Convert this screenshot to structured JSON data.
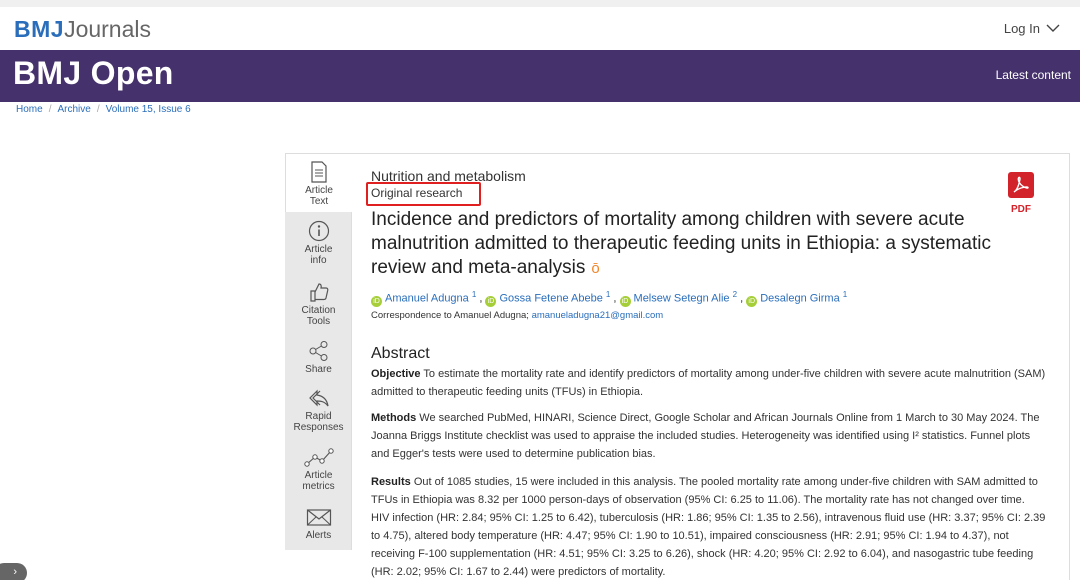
{
  "header": {
    "logo_bmj": "BMJ",
    "logo_journals": "Journals",
    "login_label": "Log In"
  },
  "banner": {
    "journal_name": "BMJ Open",
    "latest_link": "Latest content"
  },
  "breadcrumb": {
    "items": [
      "Home",
      "Archive",
      "Volume 15, Issue 6"
    ],
    "separator": "/"
  },
  "sidebar": {
    "items": [
      {
        "label_line1": "Article",
        "label_line2": "Text",
        "icon": "document-icon"
      },
      {
        "label_line1": "Article",
        "label_line2": "info",
        "icon": "info-icon"
      },
      {
        "label_line1": "Citation",
        "label_line2": "Tools",
        "icon": "thumbs-up-icon"
      },
      {
        "label_line1": "Share",
        "label_line2": "",
        "icon": "share-icon"
      },
      {
        "label_line1": "Rapid",
        "label_line2": "Responses",
        "icon": "reply-icon"
      },
      {
        "label_line1": "Article",
        "label_line2": "metrics",
        "icon": "metrics-icon"
      },
      {
        "label_line1": "Alerts",
        "label_line2": "",
        "icon": "envelope-icon"
      }
    ]
  },
  "article": {
    "subject": "Nutrition and metabolism",
    "type": "Original research",
    "title": "Incidence and predictors of mortality among children with severe acute malnutrition admitted to therapeutic feeding units in Ethiopia: a systematic review and meta-analysis",
    "authors": [
      {
        "name": "Amanuel Adugna",
        "aff": "1"
      },
      {
        "name": "Gossa Fetene Abebe",
        "aff": "1"
      },
      {
        "name": "Melsew Setegn Alie",
        "aff": "2"
      },
      {
        "name": "Desalegn Girma",
        "aff": "1"
      }
    ],
    "correspondence_label": "Correspondence to Amanuel Adugna;",
    "correspondence_email": "amanueladugna21@gmail.com",
    "pdf_label": "PDF"
  },
  "abstract": {
    "heading": "Abstract",
    "objective_label": "Objective",
    "objective_text": "To estimate the mortality rate and identify predictors of mortality among under-five children with severe acute malnutrition (SAM) admitted to therapeutic feeding units (TFUs) in Ethiopia.",
    "methods_label": "Methods",
    "methods_text": "We searched PubMed, HINARI, Science Direct, Google Scholar and African Journals Online from 1 March to 30 May 2024. The Joanna Briggs Institute checklist was used to appraise the included studies. Heterogeneity was identified using I² statistics. Funnel plots and Egger's tests were used to determine publication bias.",
    "results_label": "Results",
    "results_text": "Out of 1085 studies, 15 were included in this analysis. The pooled mortality rate among under-five children with SAM admitted to TFUs in Ethiopia was 8.32 per 1000 person-days of observation (95% CI: 6.25 to 11.06). The mortality rate has not changed over time. HIV infection (HR: 2.84; 95% CI: 1.25 to 6.42), tuberculosis (HR: 1.86; 95% CI: 1.35 to 2.56), intravenous fluid use (HR: 3.37; 95% CI: 2.39 to 4.75), altered body temperature (HR: 4.47; 95% CI: 1.90 to 10.51), impaired consciousness (HR: 2.91; 95% CI: 1.94 to 4.37), not receiving F-100 supplementation (HR: 4.51; 95% CI: 3.25 to 6.26), shock (HR: 4.20; 95% CI: 2.92 to 6.04), and nasogastric tube feeding (HR: 2.02; 95% CI: 1.67 to 2.44) were predictors of mortality."
  },
  "colors": {
    "banner": "#45316c",
    "link": "#2a6ebb",
    "highlight_box": "#e02020",
    "orcid": "#a6ce39",
    "open_access": "#f0862a",
    "pdf": "#d3232a"
  }
}
